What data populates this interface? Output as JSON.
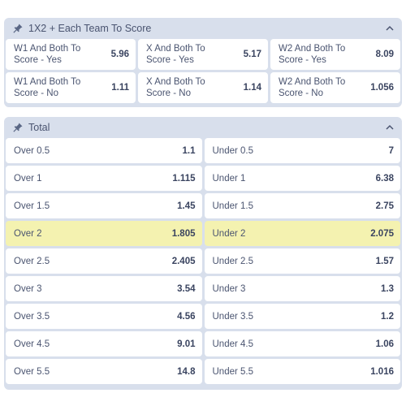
{
  "market_1x2": {
    "title": "1X2 + Each Team To Score",
    "rows": [
      [
        {
          "label": "W1 And Both To Score - Yes",
          "odds": "5.96"
        },
        {
          "label": "X And Both To Score - Yes",
          "odds": "5.17"
        },
        {
          "label": "W2 And Both To Score - Yes",
          "odds": "8.09"
        }
      ],
      [
        {
          "label": "W1 And Both To Score - No",
          "odds": "1.11"
        },
        {
          "label": "X And Both To Score - No",
          "odds": "1.14"
        },
        {
          "label": "W2 And Both To Score - No",
          "odds": "1.056"
        }
      ]
    ]
  },
  "market_total": {
    "title": "Total",
    "rows": [
      {
        "over": {
          "label": "Over 0.5",
          "odds": "1.1"
        },
        "under": {
          "label": "Under 0.5",
          "odds": "7"
        }
      },
      {
        "over": {
          "label": "Over 1",
          "odds": "1.115"
        },
        "under": {
          "label": "Under 1",
          "odds": "6.38"
        }
      },
      {
        "over": {
          "label": "Over 1.5",
          "odds": "1.45"
        },
        "under": {
          "label": "Under 1.5",
          "odds": "2.75"
        }
      },
      {
        "over": {
          "label": "Over 2",
          "odds": "1.805"
        },
        "under": {
          "label": "Under 2",
          "odds": "2.075"
        },
        "highlighted": true
      },
      {
        "over": {
          "label": "Over 2.5",
          "odds": "2.405"
        },
        "under": {
          "label": "Under 2.5",
          "odds": "1.57"
        }
      },
      {
        "over": {
          "label": "Over 3",
          "odds": "3.54"
        },
        "under": {
          "label": "Under 3",
          "odds": "1.3"
        }
      },
      {
        "over": {
          "label": "Over 3.5",
          "odds": "4.56"
        },
        "under": {
          "label": "Under 3.5",
          "odds": "1.2"
        }
      },
      {
        "over": {
          "label": "Over 4.5",
          "odds": "9.01"
        },
        "under": {
          "label": "Under 4.5",
          "odds": "1.06"
        }
      },
      {
        "over": {
          "label": "Over 5.5",
          "odds": "14.8"
        },
        "under": {
          "label": "Under 5.5",
          "odds": "1.016"
        }
      }
    ]
  },
  "icons": {
    "pin": "pin-icon",
    "collapse": "chevron-up-icon"
  },
  "colors": {
    "panel": "#d8dfec",
    "cell": "#ffffff",
    "highlight": "#f4f2b0",
    "text": "#4a5470"
  }
}
